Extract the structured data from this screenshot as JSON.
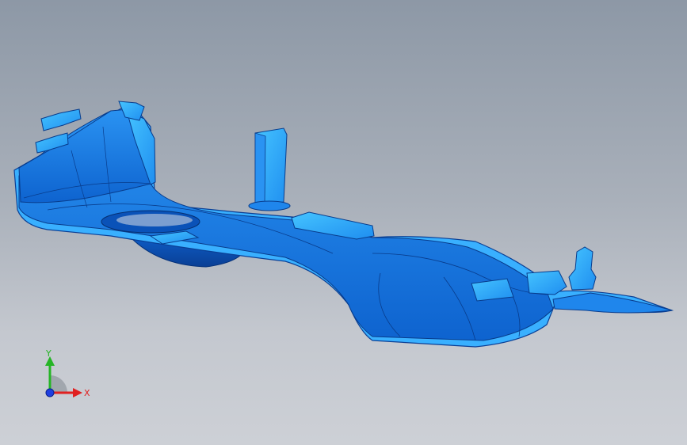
{
  "viewport": {
    "background_top": "#8d98a6",
    "background_bottom": "#cdd0d6",
    "model_color": "#1d7fe6",
    "model_highlight": "#33b6ff",
    "model_shadow": "#0b4fb5"
  },
  "triad": {
    "y_label": "Y",
    "x_label": "X",
    "y_color": "#26b526",
    "x_color": "#e02020",
    "z_color": "#1f3fe0"
  }
}
